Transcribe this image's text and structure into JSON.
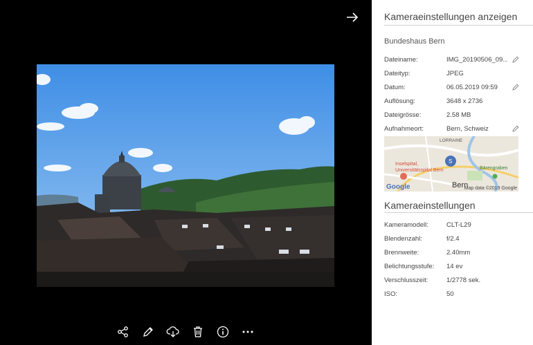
{
  "viewer": {
    "close_icon": "arrow-right-icon",
    "toolbar": [
      {
        "id": "share",
        "icon": "share-icon"
      },
      {
        "id": "edit",
        "icon": "pencil-icon"
      },
      {
        "id": "download",
        "icon": "cloud-download-icon"
      },
      {
        "id": "delete",
        "icon": "trash-icon"
      },
      {
        "id": "info",
        "icon": "info-icon"
      },
      {
        "id": "more",
        "icon": "more-icon"
      }
    ]
  },
  "panel": {
    "title": "Kameraeinstellungen anzeigen",
    "subtitle": "Bundeshaus Bern",
    "details": [
      {
        "label": "Dateiname:",
        "value": "IMG_20190506_09...",
        "editable": true
      },
      {
        "label": "Dateityp:",
        "value": "JPEG",
        "editable": false
      },
      {
        "label": "Datum:",
        "value": "06.05.2019 09:59",
        "editable": true
      },
      {
        "label": "Auflösung:",
        "value": "3648 x 2736",
        "editable": false
      },
      {
        "label": "Dateigrösse:",
        "value": "2.58 MB",
        "editable": false
      },
      {
        "label": "Aufnahmeort:",
        "value": "Bern, Schweiz",
        "editable": true
      }
    ],
    "map": {
      "labels": [
        "LORRAINE",
        "Inselspital,",
        "Universitätsspital Bern",
        "Bärengraben",
        "Bern"
      ],
      "logo": "Google",
      "credit": "Map data ©2019 Google"
    },
    "camera_title": "Kameraeinstellungen",
    "camera": [
      {
        "label": "Kameramodell:",
        "value": "CLT-L29"
      },
      {
        "label": "Blendenzahl:",
        "value": "f/2.4"
      },
      {
        "label": "Brennweite:",
        "value": "2.40mm"
      },
      {
        "label": "Belichtungsstufe:",
        "value": "14 ev"
      },
      {
        "label": "Verschlusszeit:",
        "value": "1/2778 sek."
      },
      {
        "label": "ISO:",
        "value": "50"
      }
    ]
  },
  "colors": {
    "accent": "#4a72b8",
    "panel_bg": "#ffffff",
    "viewer_bg": "#000000"
  }
}
